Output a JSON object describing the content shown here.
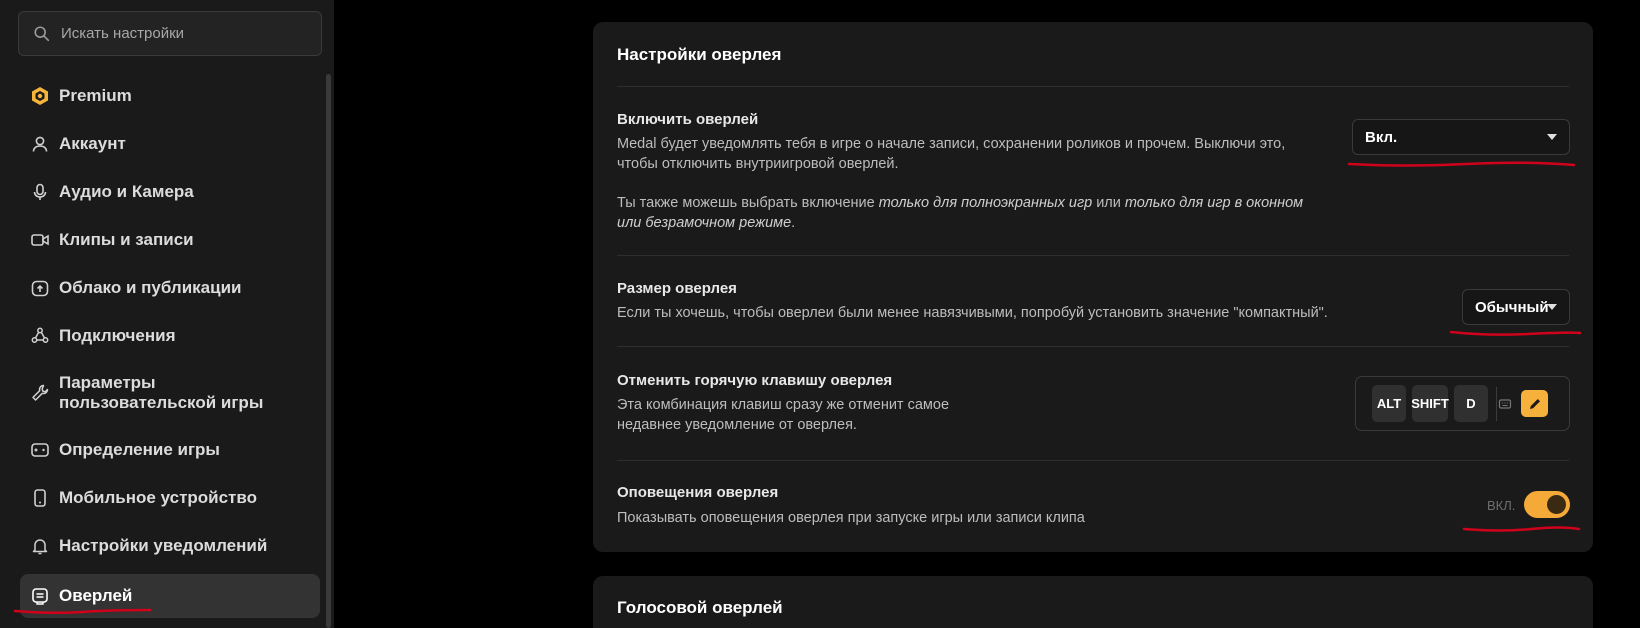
{
  "search": {
    "placeholder": "Искать настройки"
  },
  "sidebar": {
    "items": [
      {
        "label": "Premium",
        "icon": "premium-icon"
      },
      {
        "label": "Аккаунт",
        "icon": "user-icon"
      },
      {
        "label": "Аудио и Камера",
        "icon": "microphone-icon"
      },
      {
        "label": "Клипы и записи",
        "icon": "video-icon"
      },
      {
        "label": "Облако и публикации",
        "icon": "cloud-upload-icon"
      },
      {
        "label": "Подключения",
        "icon": "connections-icon"
      },
      {
        "label": "Параметры пользовательской игры",
        "icon": "wrench-icon"
      },
      {
        "label": "Определение игры",
        "icon": "gamepad-icon"
      },
      {
        "label": "Мобильное устройство",
        "icon": "phone-icon"
      },
      {
        "label": "Настройки уведомлений",
        "icon": "bell-icon"
      },
      {
        "label": "Оверлей",
        "icon": "overlay-icon",
        "active": true
      }
    ]
  },
  "overlay_settings": {
    "title": "Настройки оверлея",
    "enable": {
      "title": "Включить оверлей",
      "desc_line1": "Medal будет уведомлять тебя в игре о начале записи, сохранении роликов и прочем. Выключи это,",
      "desc_line2": "чтобы отключить внутриигровой оверлей.",
      "desc2_a": "Ты также можешь выбрать включение ",
      "desc2_b": "только для полноэкранных игр",
      "desc2_c": " или ",
      "desc2_d": "только для игр в оконном",
      "desc2_e": "или безрамочном режиме",
      "desc2_f": ".",
      "value": "Вкл."
    },
    "size": {
      "title": "Размер оверлея",
      "desc": "Если ты хочешь, чтобы оверлеи были менее навязчивыми, попробуй установить значение \"компактный\".",
      "value": "Обычный"
    },
    "cancel_hotkey": {
      "title": "Отменить горячую клавишу оверлея",
      "desc_line1": "Эта комбинация клавиш сразу же отменит самое",
      "desc_line2": "недавнее уведомление от оверлея.",
      "keys": [
        "ALT",
        "SHIFT",
        "D"
      ]
    },
    "notifications": {
      "title": "Оповещения оверлея",
      "desc": "Показывать оповещения оверлея при запуске игры или записи клипа",
      "toggle_label": "ВКЛ.",
      "toggle_on": true
    }
  },
  "voice_overlay": {
    "title": "Голосовой оверлей"
  },
  "colors": {
    "accent": "#f5a938",
    "annotation": "#d0021b"
  }
}
